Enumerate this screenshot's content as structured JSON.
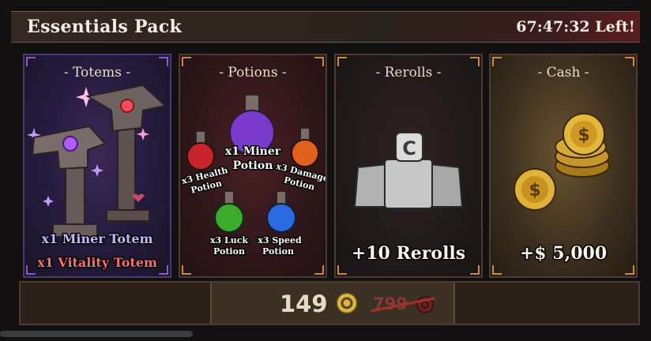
{
  "header": {
    "title": "Essentials Pack",
    "timer": "67:47:32 Left!"
  },
  "cards": [
    {
      "label": "- Totems -",
      "items": [
        "x1 Miner Totem",
        "x1 Vitality Totem"
      ]
    },
    {
      "label": "- Potions -",
      "center": [
        "x1 Miner",
        "Potion"
      ],
      "health": [
        "x3 Health",
        "Potion"
      ],
      "damage": [
        "x3 Damage",
        "Potion"
      ],
      "luck": [
        "x3 Luck",
        "Potion"
      ],
      "speed": [
        "x3 Speed",
        "Potion"
      ]
    },
    {
      "label": "- Rerolls -",
      "value": "+10 Rerolls",
      "icon_letter": "C"
    },
    {
      "label": "- Cash -",
      "value": "+$ 5,000",
      "coin_symbol": "$"
    }
  ],
  "purchase": {
    "price": "149",
    "old_price": "799"
  },
  "colors": {
    "miner_totem_text": "#c7b3ff",
    "vitality_totem_text": "#ff6b6b",
    "accent_corner": "#d08840"
  },
  "icons": [
    "coin-icon",
    "totem-icon",
    "potion-icon",
    "reroll-icon",
    "cash-coin-icon"
  ]
}
